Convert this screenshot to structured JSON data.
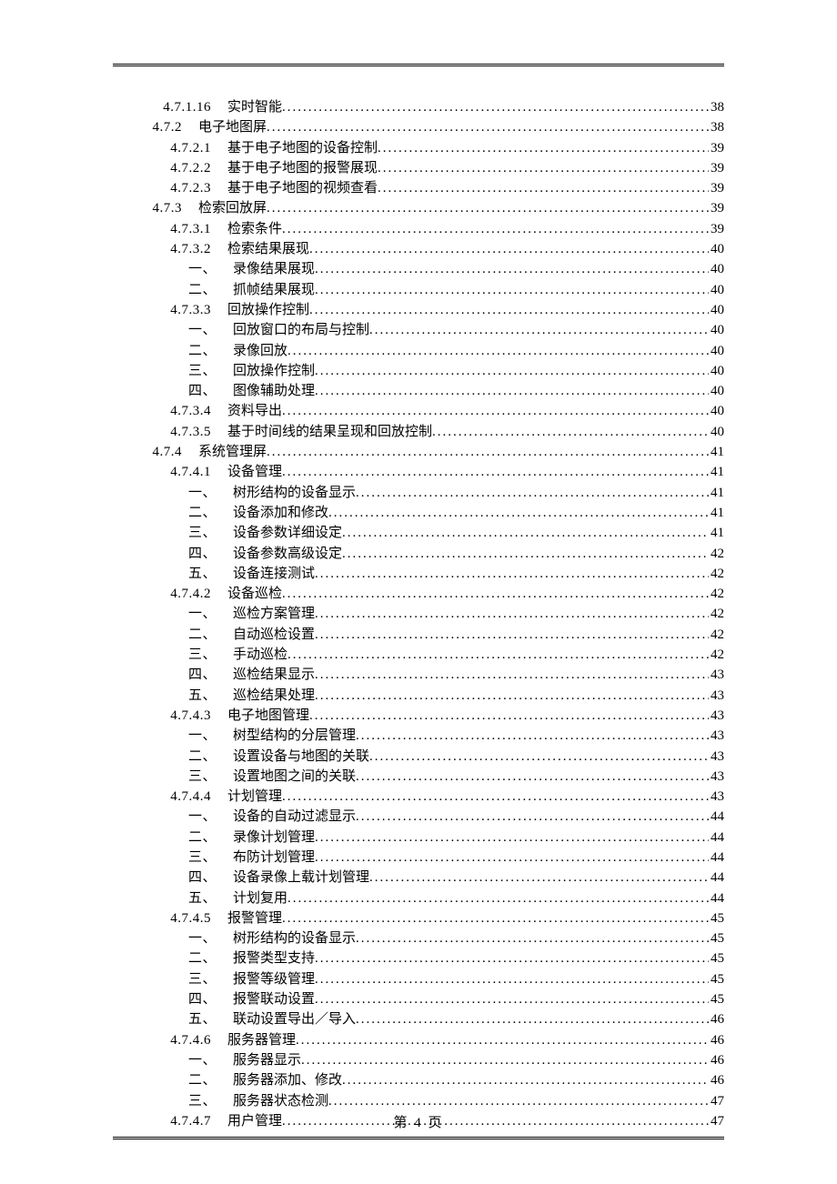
{
  "footer": "第 4 页",
  "entries": [
    {
      "lv": "lv3",
      "num": "4.7.1.16",
      "title": "实时智能",
      "page": "38"
    },
    {
      "lv": "lv2",
      "num": "4.7.2",
      "title": "电子地图屏",
      "page": "38"
    },
    {
      "lv": "lv3",
      "num": "4.7.2.1",
      "title": "基于电子地图的设备控制",
      "page": "39"
    },
    {
      "lv": "lv3",
      "num": "4.7.2.2",
      "title": "基于电子地图的报警展现",
      "page": "39"
    },
    {
      "lv": "lv3",
      "num": "4.7.2.3",
      "title": "基于电子地图的视频查看",
      "page": "39"
    },
    {
      "lv": "lv2",
      "num": "4.7.3",
      "title": "检索回放屏",
      "page": "39"
    },
    {
      "lv": "lv3",
      "num": "4.7.3.1",
      "title": "检索条件",
      "page": "39"
    },
    {
      "lv": "lv3",
      "num": "4.7.3.2",
      "title": "检索结果展现",
      "page": "40"
    },
    {
      "lv": "lv4",
      "num": "一、",
      "title": "录像结果展现",
      "page": "40"
    },
    {
      "lv": "lv4",
      "num": "二、",
      "title": "抓帧结果展现",
      "page": "40"
    },
    {
      "lv": "lv3",
      "num": "4.7.3.3",
      "title": "回放操作控制",
      "page": "40"
    },
    {
      "lv": "lv4",
      "num": "一、",
      "title": "回放窗口的布局与控制",
      "page": "40"
    },
    {
      "lv": "lv4",
      "num": "二、",
      "title": "录像回放",
      "page": "40"
    },
    {
      "lv": "lv4",
      "num": "三、",
      "title": "回放操作控制",
      "page": "40"
    },
    {
      "lv": "lv4",
      "num": "四、",
      "title": "图像辅助处理",
      "page": "40"
    },
    {
      "lv": "lv3",
      "num": "4.7.3.4",
      "title": "资料导出",
      "page": "40"
    },
    {
      "lv": "lv3",
      "num": "4.7.3.5",
      "title": "基于时间线的结果呈现和回放控制",
      "page": "40"
    },
    {
      "lv": "lv2",
      "num": "4.7.4",
      "title": "系统管理屏",
      "page": "41"
    },
    {
      "lv": "lv3",
      "num": "4.7.4.1",
      "title": "设备管理",
      "page": "41"
    },
    {
      "lv": "lv4",
      "num": "一、",
      "title": "树形结构的设备显示",
      "page": "41"
    },
    {
      "lv": "lv4",
      "num": "二、",
      "title": "设备添加和修改",
      "page": "41"
    },
    {
      "lv": "lv4",
      "num": "三、",
      "title": "设备参数详细设定",
      "page": "41"
    },
    {
      "lv": "lv4",
      "num": "四、",
      "title": "设备参数高级设定",
      "page": "42"
    },
    {
      "lv": "lv4",
      "num": "五、",
      "title": "设备连接测试",
      "page": "42"
    },
    {
      "lv": "lv3",
      "num": "4.7.4.2",
      "title": "设备巡检",
      "page": "42"
    },
    {
      "lv": "lv4",
      "num": "一、",
      "title": "巡检方案管理",
      "page": "42"
    },
    {
      "lv": "lv4",
      "num": "二、",
      "title": "自动巡检设置",
      "page": "42"
    },
    {
      "lv": "lv4",
      "num": "三、",
      "title": "手动巡检",
      "page": "42"
    },
    {
      "lv": "lv4",
      "num": "四、",
      "title": "巡检结果显示",
      "page": "43"
    },
    {
      "lv": "lv4",
      "num": "五、",
      "title": "巡检结果处理",
      "page": "43"
    },
    {
      "lv": "lv3",
      "num": "4.7.4.3",
      "title": "电子地图管理",
      "page": "43"
    },
    {
      "lv": "lv4",
      "num": "一、",
      "title": "树型结构的分层管理",
      "page": "43"
    },
    {
      "lv": "lv4",
      "num": "二、",
      "title": "设置设备与地图的关联",
      "page": "43"
    },
    {
      "lv": "lv4",
      "num": "三、",
      "title": "设置地图之间的关联",
      "page": "43"
    },
    {
      "lv": "lv3",
      "num": "4.7.4.4",
      "title": "计划管理",
      "page": "43"
    },
    {
      "lv": "lv4",
      "num": "一、",
      "title": "设备的自动过滤显示",
      "page": "44"
    },
    {
      "lv": "lv4",
      "num": "二、",
      "title": "录像计划管理",
      "page": "44"
    },
    {
      "lv": "lv4",
      "num": "三、",
      "title": "布防计划管理",
      "page": "44"
    },
    {
      "lv": "lv4",
      "num": "四、",
      "title": "设备录像上载计划管理",
      "page": "44"
    },
    {
      "lv": "lv4",
      "num": "五、",
      "title": "计划复用",
      "page": "44"
    },
    {
      "lv": "lv3",
      "num": "4.7.4.5",
      "title": "报警管理",
      "page": "45"
    },
    {
      "lv": "lv4",
      "num": "一、",
      "title": "树形结构的设备显示",
      "page": "45"
    },
    {
      "lv": "lv4",
      "num": "二、",
      "title": "报警类型支持",
      "page": "45"
    },
    {
      "lv": "lv4",
      "num": "三、",
      "title": "报警等级管理",
      "page": "45"
    },
    {
      "lv": "lv4",
      "num": "四、",
      "title": "报警联动设置",
      "page": "45"
    },
    {
      "lv": "lv4",
      "num": "五、",
      "title": "联动设置导出／导入",
      "page": "46"
    },
    {
      "lv": "lv3",
      "num": "4.7.4.6",
      "title": "服务器管理",
      "page": "46"
    },
    {
      "lv": "lv4",
      "num": "一、",
      "title": "服务器显示",
      "page": "46"
    },
    {
      "lv": "lv4",
      "num": "二、",
      "title": "服务器添加、修改",
      "page": "46"
    },
    {
      "lv": "lv4",
      "num": "三、",
      "title": "服务器状态检测",
      "page": "47"
    },
    {
      "lv": "lv3",
      "num": "4.7.4.7",
      "title": "用户管理",
      "page": "47"
    }
  ]
}
